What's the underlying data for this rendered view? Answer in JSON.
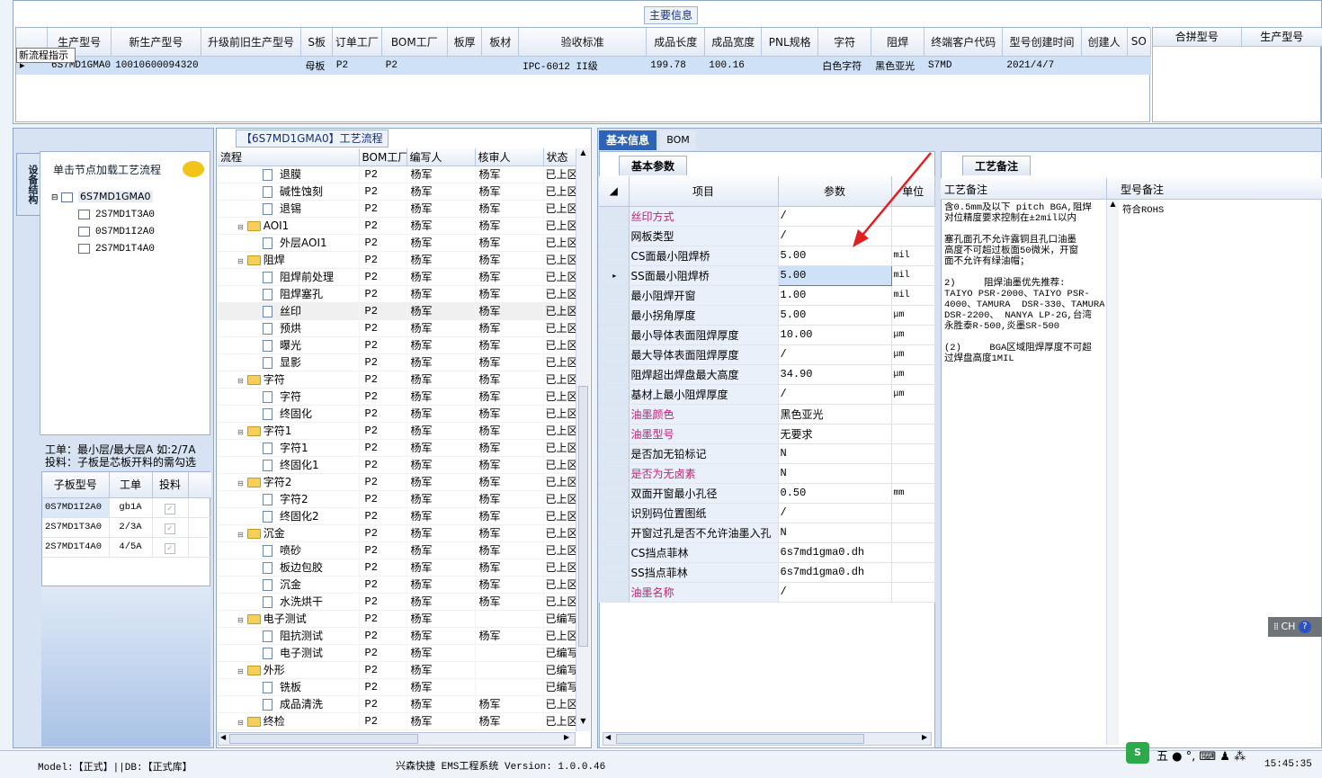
{
  "top": {
    "section_title": "主要信息",
    "tooltip": "新流程指示",
    "columns": [
      "生产型号",
      "新生产型号",
      "升级前旧生产型号",
      "S板",
      "订单工厂",
      "BOM工厂",
      "板厚",
      "板材",
      "验收标准",
      "成品长度",
      "成品宽度",
      "PNL规格",
      "字符",
      "阻焊",
      "终端客户代码",
      "型号创建时间",
      "创建人",
      "SO"
    ],
    "row": [
      "6S7MD1GMA0",
      "10010600094320",
      "",
      "母板",
      "P2",
      "P2",
      "",
      "",
      "IPC-6012 II级",
      "199.78",
      "100.16",
      "",
      "白色字符",
      "黑色亚光",
      "S7MD",
      "2021/4/7",
      "",
      ""
    ],
    "side_columns": [
      "合拼型号",
      "生产型号"
    ]
  },
  "left": {
    "vtab": "设备结构",
    "hint": "单击节点加载工艺流程",
    "tree_root": "6S7MD1GMA0",
    "tree_children": [
      "2S7MD1T3A0",
      "0S7MD1I2A0",
      "2S7MD1T4A0"
    ],
    "note1": "工单：最小层/最大层A 如:2/7A",
    "note2": "投料：子板是芯板开料的需勾选",
    "sub_columns": [
      "子板型号",
      "工单",
      "投料"
    ],
    "sub_rows": [
      {
        "model": "0S7MD1I2A0",
        "order": "gb1A"
      },
      {
        "model": "2S7MD1T3A0",
        "order": "2/3A"
      },
      {
        "model": "2S7MD1T4A0",
        "order": "4/5A"
      }
    ]
  },
  "mid": {
    "title": "【6S7MD1GMA0】工艺流程",
    "columns": [
      "流程",
      "BOM工厂",
      "编写人",
      "核审人",
      "状态"
    ],
    "rows": [
      {
        "name": "退膜",
        "type": "doc",
        "bom": "P2",
        "writer": "杨军",
        "reviewer": "杨军",
        "status": "已上区"
      },
      {
        "name": "碱性蚀刻",
        "type": "doc",
        "bom": "P2",
        "writer": "杨军",
        "reviewer": "杨军",
        "status": "已上区"
      },
      {
        "name": "退锡",
        "type": "doc",
        "bom": "P2",
        "writer": "杨军",
        "reviewer": "杨军",
        "status": "已上区"
      },
      {
        "name": "AOI1",
        "type": "folder",
        "bom": "P2",
        "writer": "杨军",
        "reviewer": "杨军",
        "status": "已上区"
      },
      {
        "name": "外层AOI1",
        "type": "doc",
        "bom": "P2",
        "writer": "杨军",
        "reviewer": "杨军",
        "status": "已上区"
      },
      {
        "name": "阻焊",
        "type": "folder",
        "bom": "P2",
        "writer": "杨军",
        "reviewer": "杨军",
        "status": "已上区"
      },
      {
        "name": "阻焊前处理",
        "type": "doc",
        "bom": "P2",
        "writer": "杨军",
        "reviewer": "杨军",
        "status": "已上区"
      },
      {
        "name": "阻焊塞孔",
        "type": "doc",
        "bom": "P2",
        "writer": "杨军",
        "reviewer": "杨军",
        "status": "已上区"
      },
      {
        "name": "丝印",
        "type": "doc",
        "bom": "P2",
        "writer": "杨军",
        "reviewer": "杨军",
        "status": "已上区"
      },
      {
        "name": "预烘",
        "type": "doc",
        "bom": "P2",
        "writer": "杨军",
        "reviewer": "杨军",
        "status": "已上区"
      },
      {
        "name": "曝光",
        "type": "doc",
        "bom": "P2",
        "writer": "杨军",
        "reviewer": "杨军",
        "status": "已上区"
      },
      {
        "name": "显影",
        "type": "doc",
        "bom": "P2",
        "writer": "杨军",
        "reviewer": "杨军",
        "status": "已上区"
      },
      {
        "name": "字符",
        "type": "folder",
        "bom": "P2",
        "writer": "杨军",
        "reviewer": "杨军",
        "status": "已上区"
      },
      {
        "name": "字符",
        "type": "doc",
        "bom": "P2",
        "writer": "杨军",
        "reviewer": "杨军",
        "status": "已上区"
      },
      {
        "name": "终固化",
        "type": "doc",
        "bom": "P2",
        "writer": "杨军",
        "reviewer": "杨军",
        "status": "已上区"
      },
      {
        "name": "字符1",
        "type": "folder",
        "bom": "P2",
        "writer": "杨军",
        "reviewer": "杨军",
        "status": "已上区"
      },
      {
        "name": "字符1",
        "type": "doc",
        "bom": "P2",
        "writer": "杨军",
        "reviewer": "杨军",
        "status": "已上区"
      },
      {
        "name": "终固化1",
        "type": "doc",
        "bom": "P2",
        "writer": "杨军",
        "reviewer": "杨军",
        "status": "已上区"
      },
      {
        "name": "字符2",
        "type": "folder",
        "bom": "P2",
        "writer": "杨军",
        "reviewer": "杨军",
        "status": "已上区"
      },
      {
        "name": "字符2",
        "type": "doc",
        "bom": "P2",
        "writer": "杨军",
        "reviewer": "杨军",
        "status": "已上区"
      },
      {
        "name": "终固化2",
        "type": "doc",
        "bom": "P2",
        "writer": "杨军",
        "reviewer": "杨军",
        "status": "已上区"
      },
      {
        "name": "沉金",
        "type": "folder",
        "bom": "P2",
        "writer": "杨军",
        "reviewer": "杨军",
        "status": "已上区"
      },
      {
        "name": "喷砂",
        "type": "doc",
        "bom": "P2",
        "writer": "杨军",
        "reviewer": "杨军",
        "status": "已上区"
      },
      {
        "name": "板边包胶",
        "type": "doc",
        "bom": "P2",
        "writer": "杨军",
        "reviewer": "杨军",
        "status": "已上区"
      },
      {
        "name": "沉金",
        "type": "doc",
        "bom": "P2",
        "writer": "杨军",
        "reviewer": "杨军",
        "status": "已上区"
      },
      {
        "name": "水洗烘干",
        "type": "doc",
        "bom": "P2",
        "writer": "杨军",
        "reviewer": "杨军",
        "status": "已上区"
      },
      {
        "name": "电子测试",
        "type": "folder",
        "bom": "P2",
        "writer": "杨军",
        "reviewer": "",
        "status": "已编写"
      },
      {
        "name": "阻抗测试",
        "type": "doc",
        "bom": "P2",
        "writer": "杨军",
        "reviewer": "杨军",
        "status": "已上区"
      },
      {
        "name": "电子测试",
        "type": "doc",
        "bom": "P2",
        "writer": "杨军",
        "reviewer": "",
        "status": "已编写"
      },
      {
        "name": "外形",
        "type": "folder",
        "bom": "P2",
        "writer": "杨军",
        "reviewer": "",
        "status": "已编写"
      },
      {
        "name": "铣板",
        "type": "doc",
        "bom": "P2",
        "writer": "杨军",
        "reviewer": "",
        "status": "已编写"
      },
      {
        "name": "成品清洗",
        "type": "doc",
        "bom": "P2",
        "writer": "杨军",
        "reviewer": "杨军",
        "status": "已上区"
      },
      {
        "name": "终检",
        "type": "folder",
        "bom": "P2",
        "writer": "杨军",
        "reviewer": "杨军",
        "status": "已上区"
      }
    ]
  },
  "right": {
    "tabs": [
      "基本信息",
      "BOM"
    ],
    "subtab": "基本参数",
    "columns": [
      "项目",
      "参数",
      "单位"
    ],
    "rows": [
      {
        "item": "丝印方式",
        "value": "/",
        "unit": "",
        "pink": true
      },
      {
        "item": "网板类型",
        "value": "/",
        "unit": "",
        "pink": false
      },
      {
        "item": "CS面最小阻焊桥",
        "value": "5.00",
        "unit": "mil",
        "pink": false
      },
      {
        "item": "SS面最小阻焊桥",
        "value": "5.00",
        "unit": "mil",
        "pink": false
      },
      {
        "item": "最小阻焊开窗",
        "value": "1.00",
        "unit": "mil",
        "pink": false
      },
      {
        "item": "最小拐角厚度",
        "value": "5.00",
        "unit": "μm",
        "pink": false
      },
      {
        "item": "最小导体表面阻焊厚度",
        "value": "10.00",
        "unit": "μm",
        "pink": false
      },
      {
        "item": "最大导体表面阻焊厚度",
        "value": "/",
        "unit": "μm",
        "pink": false
      },
      {
        "item": "阻焊超出焊盘最大高度",
        "value": "34.90",
        "unit": "μm",
        "pink": false
      },
      {
        "item": "基材上最小阻焊厚度",
        "value": "/",
        "unit": "μm",
        "pink": false
      },
      {
        "item": "油墨颜色",
        "value": "黑色亚光",
        "unit": "",
        "pink": true
      },
      {
        "item": "油墨型号",
        "value": "无要求",
        "unit": "",
        "pink": true
      },
      {
        "item": "是否加无铅标记",
        "value": "N",
        "unit": "",
        "pink": false
      },
      {
        "item": "是否为无卤素",
        "value": "N",
        "unit": "",
        "pink": true
      },
      {
        "item": "双面开窗最小孔径",
        "value": "0.50",
        "unit": "mm",
        "pink": false
      },
      {
        "item": "识别码位置图纸",
        "value": "/",
        "unit": "",
        "pink": false
      },
      {
        "item": "开窗过孔是否不允许油墨入孔",
        "value": "N",
        "unit": "",
        "pink": false
      },
      {
        "item": "CS挡点菲林",
        "value": "6s7md1gma0.dh",
        "unit": "",
        "pink": false
      },
      {
        "item": "SS挡点菲林",
        "value": "6s7md1gma0.dh",
        "unit": "",
        "pink": false
      },
      {
        "item": "油墨名称",
        "value": "/",
        "unit": "",
        "pink": true
      }
    ],
    "notes_tab": "工艺备注",
    "notes_col1": "工艺备注",
    "notes_col2": "型号备注",
    "note_lines": [
      "含0.5mm及以下 pitch BGA,阻焊",
      "对位精度要求控制在±2mil以内",
      "",
      "塞孔面孔不允许露铜且孔口油墨",
      "高度不可超过板面50微米，开窗",
      "面不允许有绿油帽；",
      "",
      "2)     阻焊油墨优先推荐:",
      "TAIYO PSR-2000、TAIYO PSR-",
      "4000、TAMURA  DSR-330、TAMURA",
      "DSR-2200、 NANYA LP-2G,台湾",
      "永胜泰R-500,炎墨SR-500",
      "",
      "(2)     BGA区域阻焊厚度不可超",
      "过焊盘高度1MIL"
    ],
    "model_note": "符合ROHS"
  },
  "ime": {
    "label": "CH",
    "help": "?",
    "wubi": "五"
  },
  "status": {
    "left": "Model:【正式】||DB:【正式库】",
    "center": "兴森快捷 EMS工程系统 Version: 1.0.0.46",
    "time": "15:45:35"
  }
}
